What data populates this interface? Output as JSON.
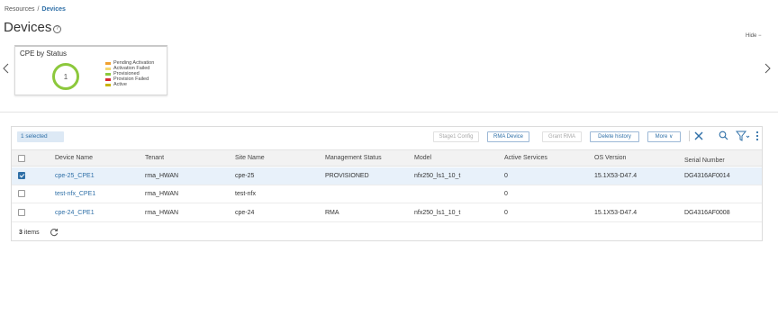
{
  "breadcrumb": {
    "parent": "Resources",
    "separator": "/",
    "current": "Devices"
  },
  "page": {
    "title": "Devices",
    "help_glyph": "?",
    "hide_label": "Hide −"
  },
  "card": {
    "title": "CPE by Status",
    "center_value": "1",
    "donut_color": "#8cc83c",
    "legend": [
      {
        "label": "Pending Activation",
        "color": "#f0a030"
      },
      {
        "label": "Activation Failed",
        "color": "#f5d76e"
      },
      {
        "label": "Provisioned",
        "color": "#8cc83c"
      },
      {
        "label": "Provision Failed",
        "color": "#d9282f"
      },
      {
        "label": "Active",
        "color": "#c8b400"
      }
    ]
  },
  "toolbar": {
    "selected_label": "1 selected",
    "buttons": {
      "stage1": "Stage1 Config",
      "rma_device": "RMA Device",
      "grant_rma": "Grant RMA",
      "delete_history": "Delete history",
      "more": "More ∨"
    },
    "icons": [
      "close-icon",
      "search-icon",
      "filter-icon",
      "kebab-menu-icon"
    ],
    "accent": "#2e6fa7"
  },
  "table": {
    "columns": [
      "Device Name",
      "Tenant",
      "Site Name",
      "Management Status",
      "Model",
      "Active Services",
      "OS Version",
      "Serial Number"
    ],
    "rows": [
      {
        "selected": true,
        "device": "cpe-25_CPE1",
        "tenant": "rma_HWAN",
        "site": "cpe-25",
        "status": "PROVISIONED",
        "model": "nfx250_ls1_10_t",
        "services": "0",
        "os": "15.1X53-D47.4",
        "serial": "DG4316AF0014"
      },
      {
        "selected": false,
        "device": "test-nfx_CPE1",
        "tenant": "rma_HWAN",
        "site": "test-nfx",
        "status": "",
        "model": "",
        "services": "0",
        "os": "",
        "serial": ""
      },
      {
        "selected": false,
        "device": "cpe-24_CPE1",
        "tenant": "rma_HWAN",
        "site": "cpe-24",
        "status": "RMA",
        "model": "nfx250_ls1_10_t",
        "services": "0",
        "os": "15.1X53-D47.4",
        "serial": "DG4316AF0008"
      }
    ]
  },
  "footer": {
    "count": "3",
    "count_suffix": "items"
  }
}
